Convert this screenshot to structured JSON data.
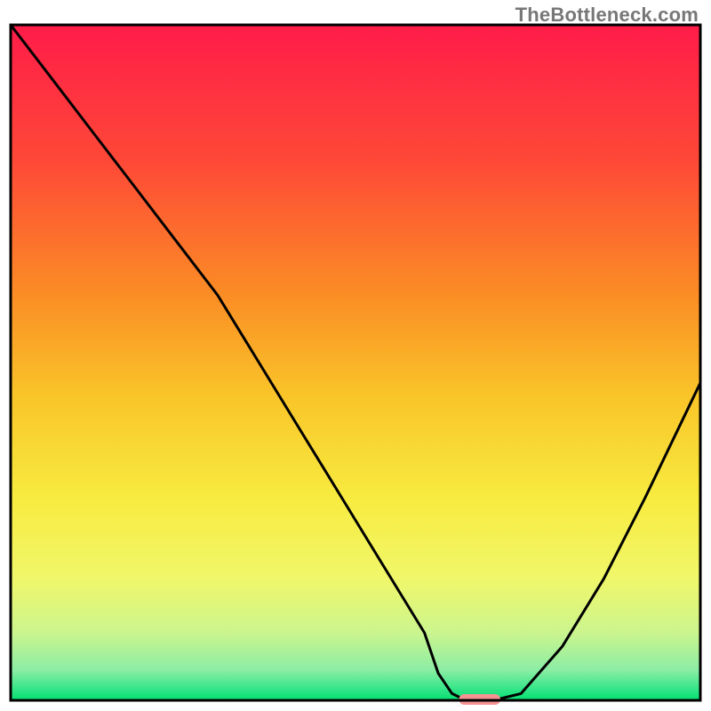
{
  "watermark": "TheBottleneck.com",
  "chart_data": {
    "type": "line",
    "title": "",
    "xlabel": "",
    "ylabel": "",
    "xlim": [
      0,
      100
    ],
    "ylim": [
      0,
      100
    ],
    "grid": false,
    "legend": false,
    "background": {
      "type": "vertical-gradient",
      "stops": [
        {
          "pos": 0.0,
          "color": "#FF1C49"
        },
        {
          "pos": 0.2,
          "color": "#FE4837"
        },
        {
          "pos": 0.4,
          "color": "#FB8D25"
        },
        {
          "pos": 0.55,
          "color": "#F9C529"
        },
        {
          "pos": 0.7,
          "color": "#F8EB3F"
        },
        {
          "pos": 0.82,
          "color": "#F0F76A"
        },
        {
          "pos": 0.9,
          "color": "#CBF58E"
        },
        {
          "pos": 0.955,
          "color": "#8CEDA4"
        },
        {
          "pos": 0.985,
          "color": "#2FE587"
        },
        {
          "pos": 1.0,
          "color": "#05E06F"
        }
      ]
    },
    "series": [
      {
        "name": "bottleneck-curve",
        "color": "#000000",
        "x": [
          0,
          6,
          12,
          18,
          24,
          30,
          36,
          42,
          48,
          54,
          60,
          62,
          64,
          66,
          70,
          74,
          80,
          86,
          92,
          100
        ],
        "y": [
          100,
          92,
          84,
          76,
          68,
          60,
          50,
          40,
          30,
          20,
          10,
          4,
          1,
          0,
          0,
          1,
          8,
          18,
          30,
          47
        ]
      }
    ],
    "marker": {
      "name": "highlight-region",
      "x_center": 68,
      "y": 0,
      "width": 6,
      "color": "#F59393"
    },
    "frame": {
      "color": "#000000",
      "width": 3
    }
  }
}
